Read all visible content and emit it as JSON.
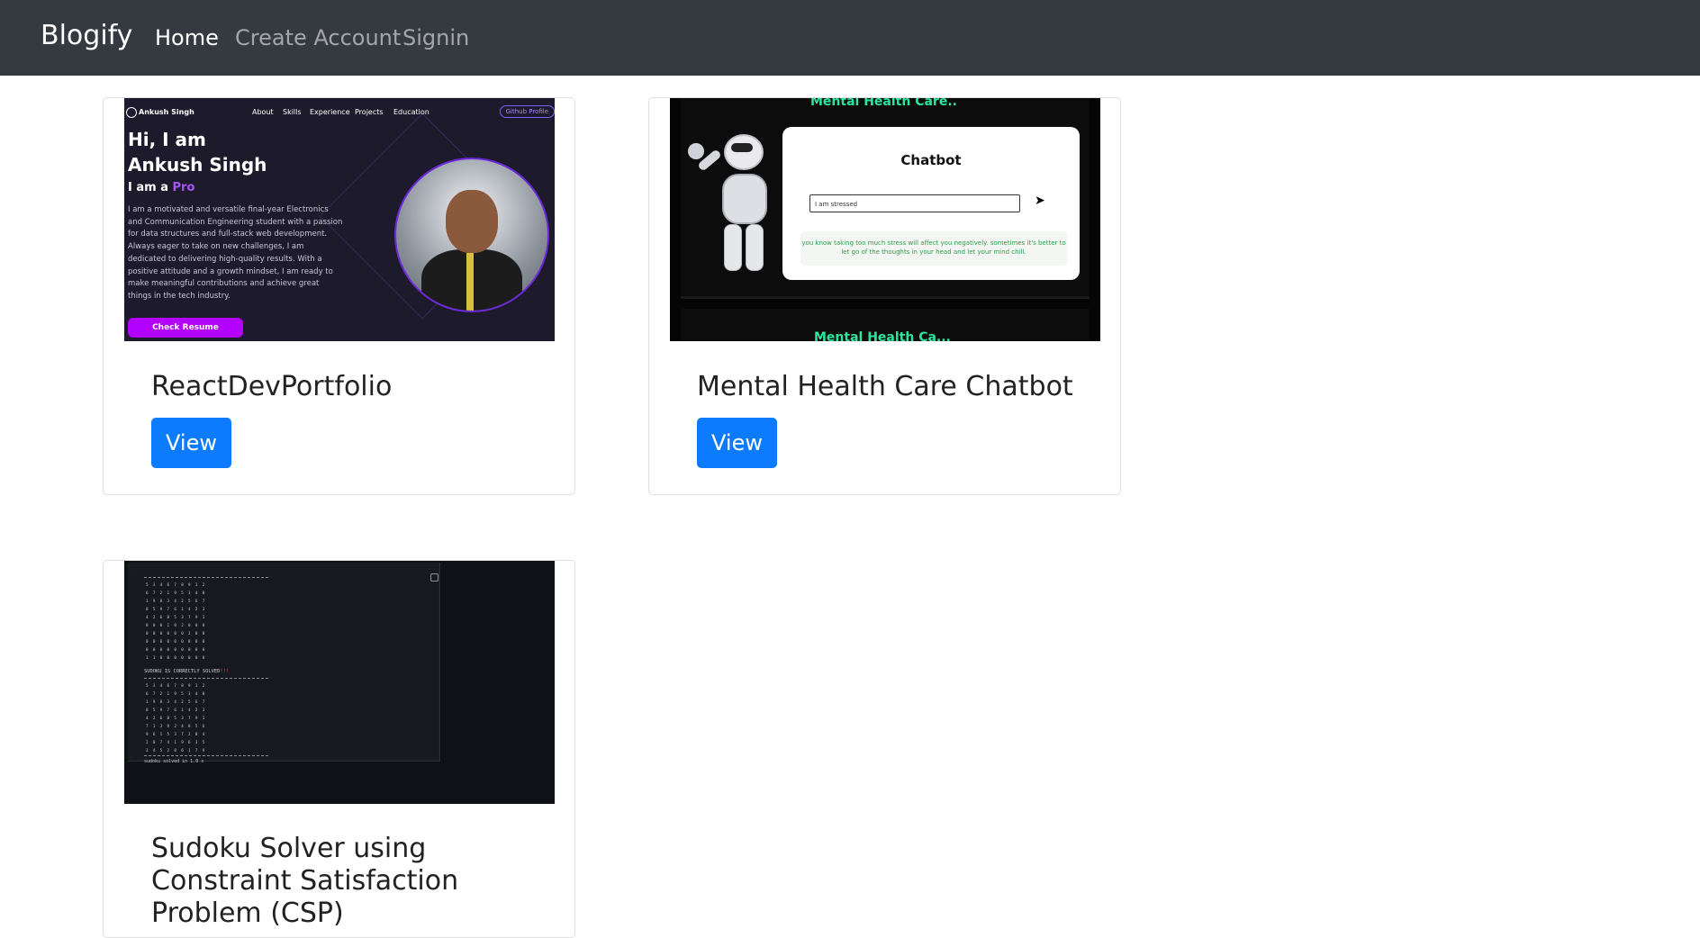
{
  "navbar": {
    "brand": "Blogify",
    "links": [
      {
        "label": "Home",
        "active": true
      },
      {
        "label": "Create Account",
        "active": false
      },
      {
        "label": "Signin",
        "active": false
      }
    ]
  },
  "cards": [
    {
      "title": "ReactDevPortfolio",
      "button_label": "View",
      "thumbnail": {
        "logo_name": "Ankush Singh",
        "menu": [
          "About",
          "Skills",
          "Experience",
          "Projects",
          "Education"
        ],
        "github_button": "Github Profile",
        "greeting_line1": "Hi, I am",
        "greeting_line2": "Ankush Singh",
        "role_prefix": "I am a",
        "role": "Pro",
        "bio": "I am a motivated and versatile final-year Electronics and Communication Engineering student with a passion for data structures and full-stack web development. Always eager to take on new challenges, I am dedicated to delivering high-quality results. With a positive attitude and a growth mindset, I am ready to make meaningful contributions and achieve great things in the tech industry.",
        "cta": "Check Resume"
      }
    },
    {
      "title": "Mental Health Care Chatbot",
      "button_label": "View",
      "thumbnail": {
        "heading": "Mental Health Care..",
        "chatbot_title": "Chatbot",
        "input_value": "I am stressed",
        "send_icon": "send-arrow-icon",
        "reply": "you know taking too much stress will affect you negatively. sometimes it's better to let go of the thoughts in your head and let your mind chill.",
        "heading_bottom": "Mental Health Ca..."
      }
    },
    {
      "title": "Sudoku Solver using Constraint Satisfaction Problem (CSP)",
      "button_label": "View",
      "thumbnail": {
        "grid_top": "5 3 4 6 7 8 9 1 2\n6 7 2 1 9 5 3 4 8\n1 9 8 3 4 2 5 6 7\n8 5 9 7 6 1 4 2 3\n4 2 6 8 5 3 7 9 1\n0 0 0 1 0 2 0 0 0\n0 0 0 0 0 0 2 0 0\n0 0 0 0 0 0 8 0 0\n0 0 0 0 0 0 0 0 0\n1 1 0 0 0 0 0 0 0",
        "message": "SUDOKU IS CORRECTLY SOLVED",
        "message_mark": "!!!",
        "grid_bottom": "5 3 4 6 7 8 9 1 2\n6 7 2 1 9 5 3 4 8\n1 9 8 3 4 2 5 6 7\n8 5 9 7 6 1 4 2 3\n4 2 6 8 5 3 7 9 1\n7 1 3 9 2 4 8 5 6\n9 6 1 5 3 7 2 8 4\n2 8 7 4 1 9 6 3 5\n3 4 5 2 8 6 1 7 9",
        "footer": "sudoku solved in 1.0 s"
      }
    }
  ]
}
